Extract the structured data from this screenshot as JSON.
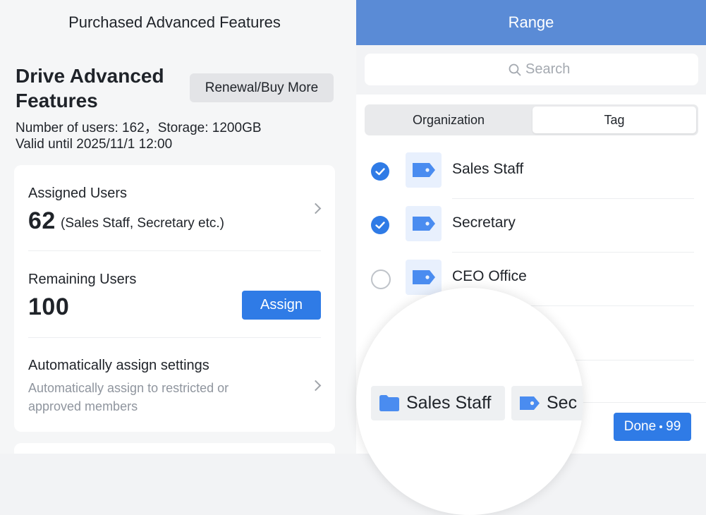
{
  "left_panel": {
    "title": "Purchased Advanced Features",
    "feature_title": "Drive Advanced Features",
    "renew_button": "Renewal/Buy More",
    "users_storage": "Number of users: 162，Storage: 1200GB",
    "valid_until": "Valid until 2025/11/1 12:00",
    "assigned": {
      "label": "Assigned Users",
      "count": "62",
      "note": "(Sales Staff, Secretary etc.)"
    },
    "remaining": {
      "label": "Remaining Users",
      "count": "100",
      "assign_button": "Assign"
    },
    "auto_assign": {
      "label": "Automatically assign settings",
      "description": "Automatically assign to restricted or approved members"
    }
  },
  "right_panel": {
    "title": "Range",
    "search_placeholder": "Search",
    "tabs": [
      {
        "label": "Organization",
        "active": false
      },
      {
        "label": "Tag",
        "active": true
      }
    ],
    "items": [
      {
        "label": "Sales Staff",
        "checked": true
      },
      {
        "label": "Secretary",
        "checked": true
      },
      {
        "label": "CEO Office",
        "checked": false
      }
    ],
    "done_button": "Done",
    "done_count": "99"
  },
  "magnifier": {
    "chips": [
      {
        "label": "Sales Staff",
        "icon": "folder-icon"
      },
      {
        "label": "Sec",
        "icon": "tag-icon"
      }
    ]
  },
  "colors": {
    "accent": "#2f7be6",
    "header": "#5a8bd6",
    "tag_icon": "#4a8cf0"
  }
}
